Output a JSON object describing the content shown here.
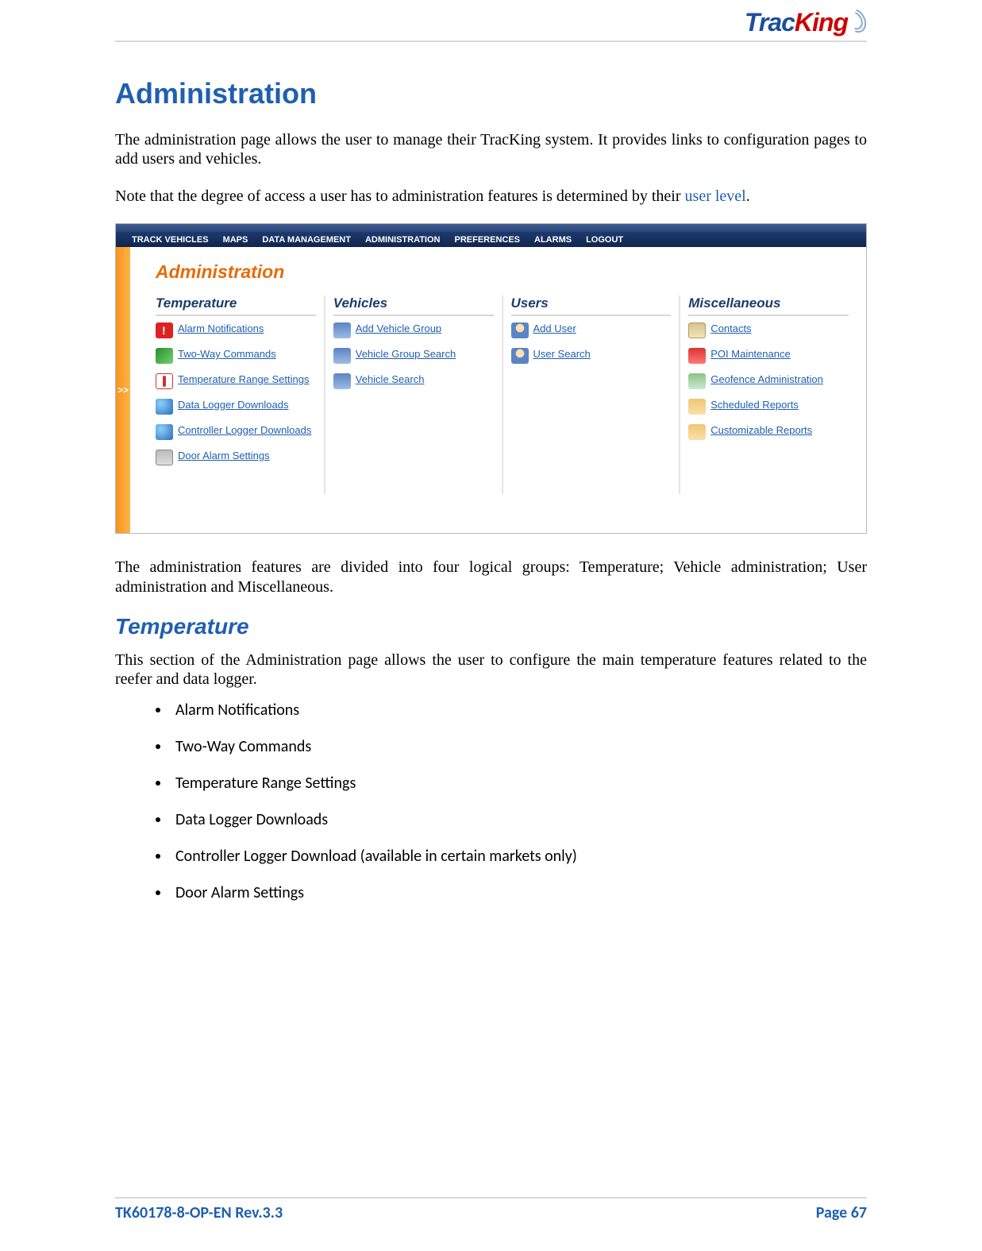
{
  "logo": {
    "part1": "Trac",
    "part2": "King"
  },
  "title": "Administration",
  "intro1": "The administration page allows the user to manage their TracKing system.  It provides links to configuration pages to add users and vehicles.",
  "intro2_pre": "Note that the degree of access a user has to administration features is determined by their ",
  "intro2_link": "user level",
  "intro2_post": ".",
  "screenshot": {
    "menu": [
      "TRACK VEHICLES",
      "MAPS",
      "DATA MANAGEMENT",
      "ADMINISTRATION",
      "PREFERENCES",
      "ALARMS",
      "LOGOUT"
    ],
    "expand": ">>",
    "pageTitle": "Administration",
    "columns": [
      {
        "title": "Temperature",
        "items": [
          {
            "icon": "ico-alarm",
            "label": "Alarm Notifications"
          },
          {
            "icon": "ico-twoway",
            "label": "Two-Way Commands"
          },
          {
            "icon": "ico-temp",
            "label": "Temperature Range Settings"
          },
          {
            "icon": "ico-globe",
            "label": "Data Logger Downloads"
          },
          {
            "icon": "ico-globe",
            "label": "Controller Logger Downloads"
          },
          {
            "icon": "ico-door",
            "label": "Door Alarm Settings"
          }
        ]
      },
      {
        "title": "Vehicles",
        "items": [
          {
            "icon": "ico-truck",
            "label": "Add Vehicle Group"
          },
          {
            "icon": "ico-truck",
            "label": "Vehicle Group Search"
          },
          {
            "icon": "ico-truck",
            "label": "Vehicle Search"
          }
        ]
      },
      {
        "title": "Users",
        "items": [
          {
            "icon": "ico-user",
            "label": "Add User"
          },
          {
            "icon": "ico-user",
            "label": "User Search"
          }
        ]
      },
      {
        "title": "Miscellaneous",
        "items": [
          {
            "icon": "ico-card",
            "label": "Contacts"
          },
          {
            "icon": "ico-house",
            "label": "POI Maintenance"
          },
          {
            "icon": "ico-geo",
            "label": "Geofence Administration"
          },
          {
            "icon": "ico-report",
            "label": "Scheduled Reports"
          },
          {
            "icon": "ico-report",
            "label": "Customizable Reports"
          }
        ]
      }
    ]
  },
  "afterShot": "The administration features are divided into four logical groups: Temperature; Vehicle administration; User administration and Miscellaneous.",
  "section2_title": "Temperature",
  "section2_intro": "This section of the Administration page allows the user to configure the main temperature features related to the reefer and data logger.",
  "bullets": [
    "Alarm Notifications",
    "Two-Way Commands",
    "Temperature Range Settings",
    "Data Logger Downloads",
    "Controller Logger Download (available in certain markets only)",
    "Door Alarm Settings"
  ],
  "footer": {
    "left": "TK60178-8-OP-EN Rev.3.3",
    "right_label": "Page  ",
    "right_num": "67"
  }
}
